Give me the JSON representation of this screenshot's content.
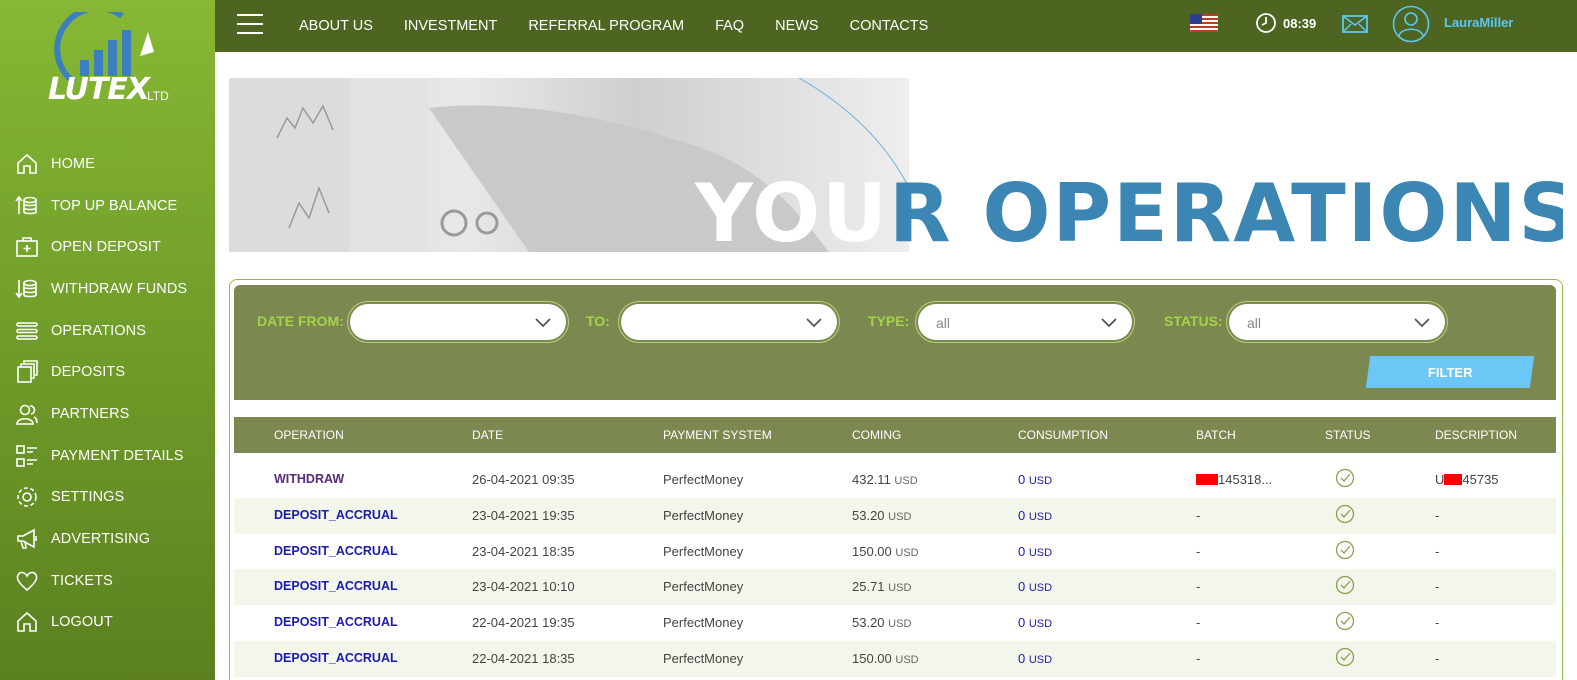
{
  "brand": {
    "name": "LUTEX",
    "suffix": "LTD"
  },
  "sidebar": {
    "items": [
      {
        "label": "HOME",
        "icon": "home-icon"
      },
      {
        "label": "TOP UP BALANCE",
        "icon": "top-up-icon"
      },
      {
        "label": "OPEN DEPOSIT",
        "icon": "open-deposit-icon"
      },
      {
        "label": "WITHDRAW FUNDS",
        "icon": "withdraw-icon"
      },
      {
        "label": "OPERATIONS",
        "icon": "operations-list-icon"
      },
      {
        "label": "DEPOSITS",
        "icon": "deposits-icon"
      },
      {
        "label": "PARTNERS",
        "icon": "partners-icon"
      },
      {
        "label": "PAYMENT DETAILS",
        "icon": "payment-details-icon"
      },
      {
        "label": "SETTINGS",
        "icon": "gear-icon"
      },
      {
        "label": "ADVERTISING",
        "icon": "megaphone-icon"
      },
      {
        "label": "TICKETS",
        "icon": "heart-icon"
      },
      {
        "label": "LOGOUT",
        "icon": "logout-home-icon"
      }
    ]
  },
  "header": {
    "nav": [
      "ABOUT US",
      "INVESTMENT",
      "REFERRAL PROGRAM",
      "FAQ",
      "NEWS",
      "CONTACTS"
    ],
    "time": "08:39",
    "username": "LauraMiller"
  },
  "banner": {
    "title_white": "YOU",
    "title_blue": "R OPERATIONS"
  },
  "filters": {
    "date_from_label": "DATE FROM:",
    "to_label": "TO:",
    "type_label": "TYPE:",
    "type_value": "all",
    "status_label": "STATUS:",
    "status_value": "all",
    "button": "FILTER"
  },
  "table": {
    "columns": [
      "OPERATION",
      "DATE",
      "PAYMENT SYSTEM",
      "COMING",
      "CONSUMPTION",
      "BATCH",
      "STATUS",
      "DESCRIPTION"
    ],
    "rows": [
      {
        "operation": "WITHDRAW",
        "date": "26-04-2021 09:35",
        "system": "PerfectMoney",
        "coming": "432.11",
        "coming_cur": "USD",
        "consumption": "0",
        "consumption_cur": "USD",
        "batch": "145318...",
        "description_a": "U",
        "description_b": "45735"
      },
      {
        "operation": "DEPOSIT_ACCRUAL",
        "date": "23-04-2021 19:35",
        "system": "PerfectMoney",
        "coming": "53.20",
        "coming_cur": "USD",
        "consumption": "0",
        "consumption_cur": "USD",
        "batch": "-",
        "description": "-"
      },
      {
        "operation": "DEPOSIT_ACCRUAL",
        "date": "23-04-2021 18:35",
        "system": "PerfectMoney",
        "coming": "150.00",
        "coming_cur": "USD",
        "consumption": "0",
        "consumption_cur": "USD",
        "batch": "-",
        "description": "-"
      },
      {
        "operation": "DEPOSIT_ACCRUAL",
        "date": "23-04-2021 10:10",
        "system": "PerfectMoney",
        "coming": "25.71",
        "coming_cur": "USD",
        "consumption": "0",
        "consumption_cur": "USD",
        "batch": "-",
        "description": "-"
      },
      {
        "operation": "DEPOSIT_ACCRUAL",
        "date": "22-04-2021 19:35",
        "system": "PerfectMoney",
        "coming": "53.20",
        "coming_cur": "USD",
        "consumption": "0",
        "consumption_cur": "USD",
        "batch": "-",
        "description": "-"
      },
      {
        "operation": "DEPOSIT_ACCRUAL",
        "date": "22-04-2021 18:35",
        "system": "PerfectMoney",
        "coming": "150.00",
        "coming_cur": "USD",
        "consumption": "0",
        "consumption_cur": "USD",
        "batch": "-",
        "description": "-"
      }
    ]
  },
  "colors": {
    "sidebar": "#7aa82e",
    "topbar": "#4d6520",
    "accent_blue": "#3c86b4",
    "button": "#6cc6f6",
    "filter_bg": "#7b8850"
  }
}
